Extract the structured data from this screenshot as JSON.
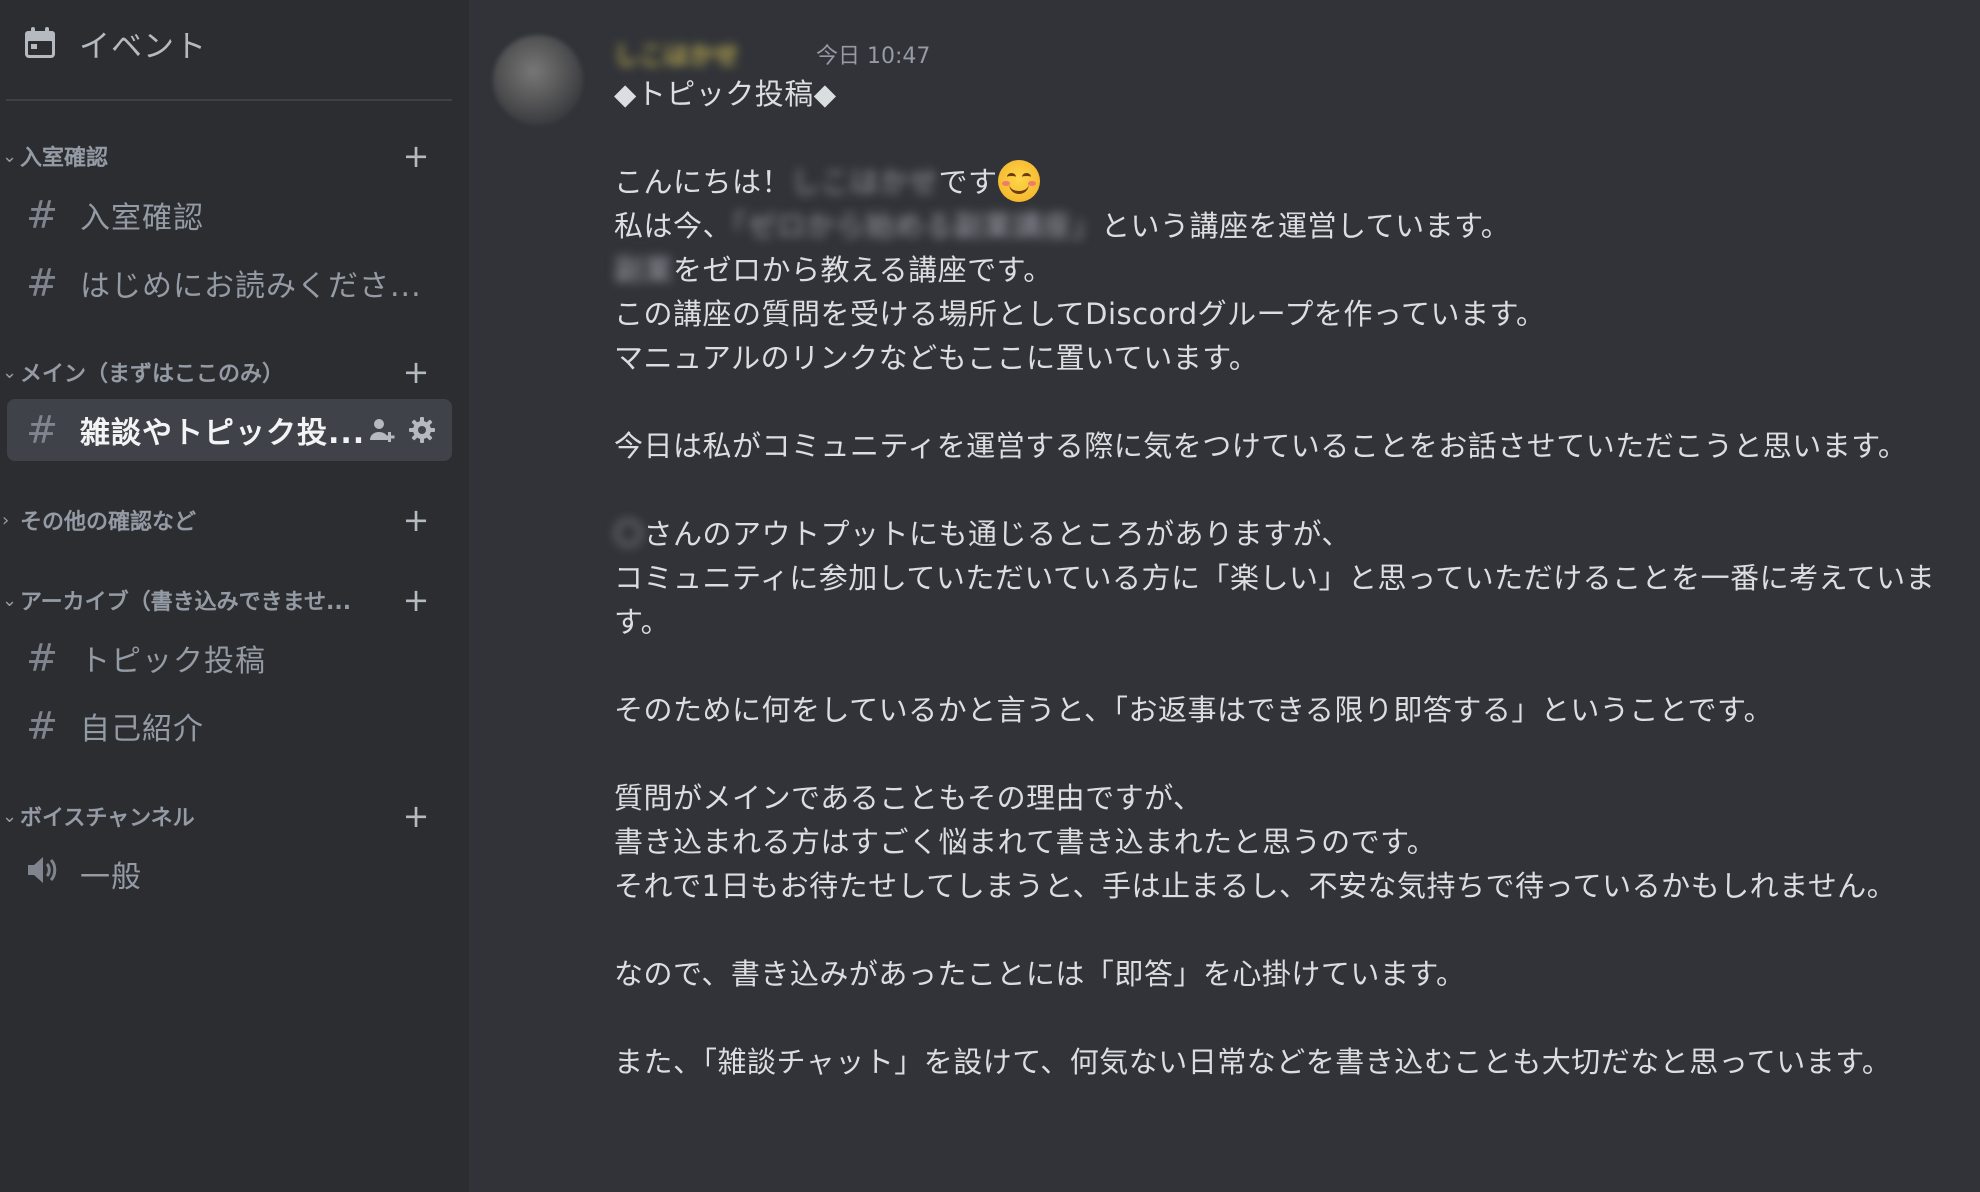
{
  "sidebar": {
    "events_label": "イベント",
    "categories": [
      {
        "name": "入室確認",
        "expanded": true
      },
      {
        "name": "メイン（まずはここのみ）",
        "expanded": true
      },
      {
        "name": "その他の確認など",
        "expanded": false
      },
      {
        "name": "アーカイブ（書き込みできませ...",
        "expanded": true
      },
      {
        "name": "ボイスチャンネル",
        "expanded": true
      }
    ],
    "channels": [
      {
        "name": "入室確認",
        "type": "text"
      },
      {
        "name": "はじめにお読みくださ...",
        "type": "text"
      },
      {
        "name": "雑談やトピック投...",
        "type": "text",
        "active": true
      },
      {
        "name": "トピック投稿",
        "type": "text"
      },
      {
        "name": "自己紹介",
        "type": "text"
      },
      {
        "name": "一般",
        "type": "voice"
      }
    ]
  },
  "message": {
    "author": "しこはかせ",
    "timestamp": "今日 10:47",
    "lines": {
      "l1": "◆トピック投稿◆",
      "l2a": "こんにちは！",
      "l2b": "しこはかせ",
      "l2c": "です",
      "l3a": "私は今、",
      "l3b": "「ゼロから始める副業講座」",
      "l3c": "という講座を運営しています。",
      "l4a": "副業",
      "l4b": "をゼロから教える講座です。",
      "l5": "この講座の質問を受ける場所としてDiscordグループを作っています。",
      "l6": "マニュアルのリンクなどもここに置いています。",
      "l7": "今日は私がコミュニティを運営する際に気をつけていることをお話させていただこうと思います。",
      "l8a": "〇",
      "l8b": "さんのアウトプットにも通じるところがありますが、",
      "l9": "コミュニティに参加していただいている方に「楽しい」と思っていただけることを一番に考えています。",
      "l10": "そのために何をしているかと言うと、「お返事はできる限り即答する」ということです。",
      "l11": "質問がメインであることもその理由ですが、",
      "l12": "書き込まれる方はすごく悩まれて書き込まれたと思うのです。",
      "l13": "それで1日もお待たせしてしまうと、手は止まるし、不安な気持ちで待っているかもしれません。",
      "l14": "なので、書き込みがあったことには「即答」を心掛けています。",
      "l15": "また、「雑談チャット」を設けて、何気ない日常などを書き込むことも大切だなと思っています。"
    }
  },
  "colors": {
    "sidebar_bg": "#2b2d31",
    "chat_bg": "#313338",
    "active_channel_bg": "#404249",
    "username": "#e8d25b"
  }
}
